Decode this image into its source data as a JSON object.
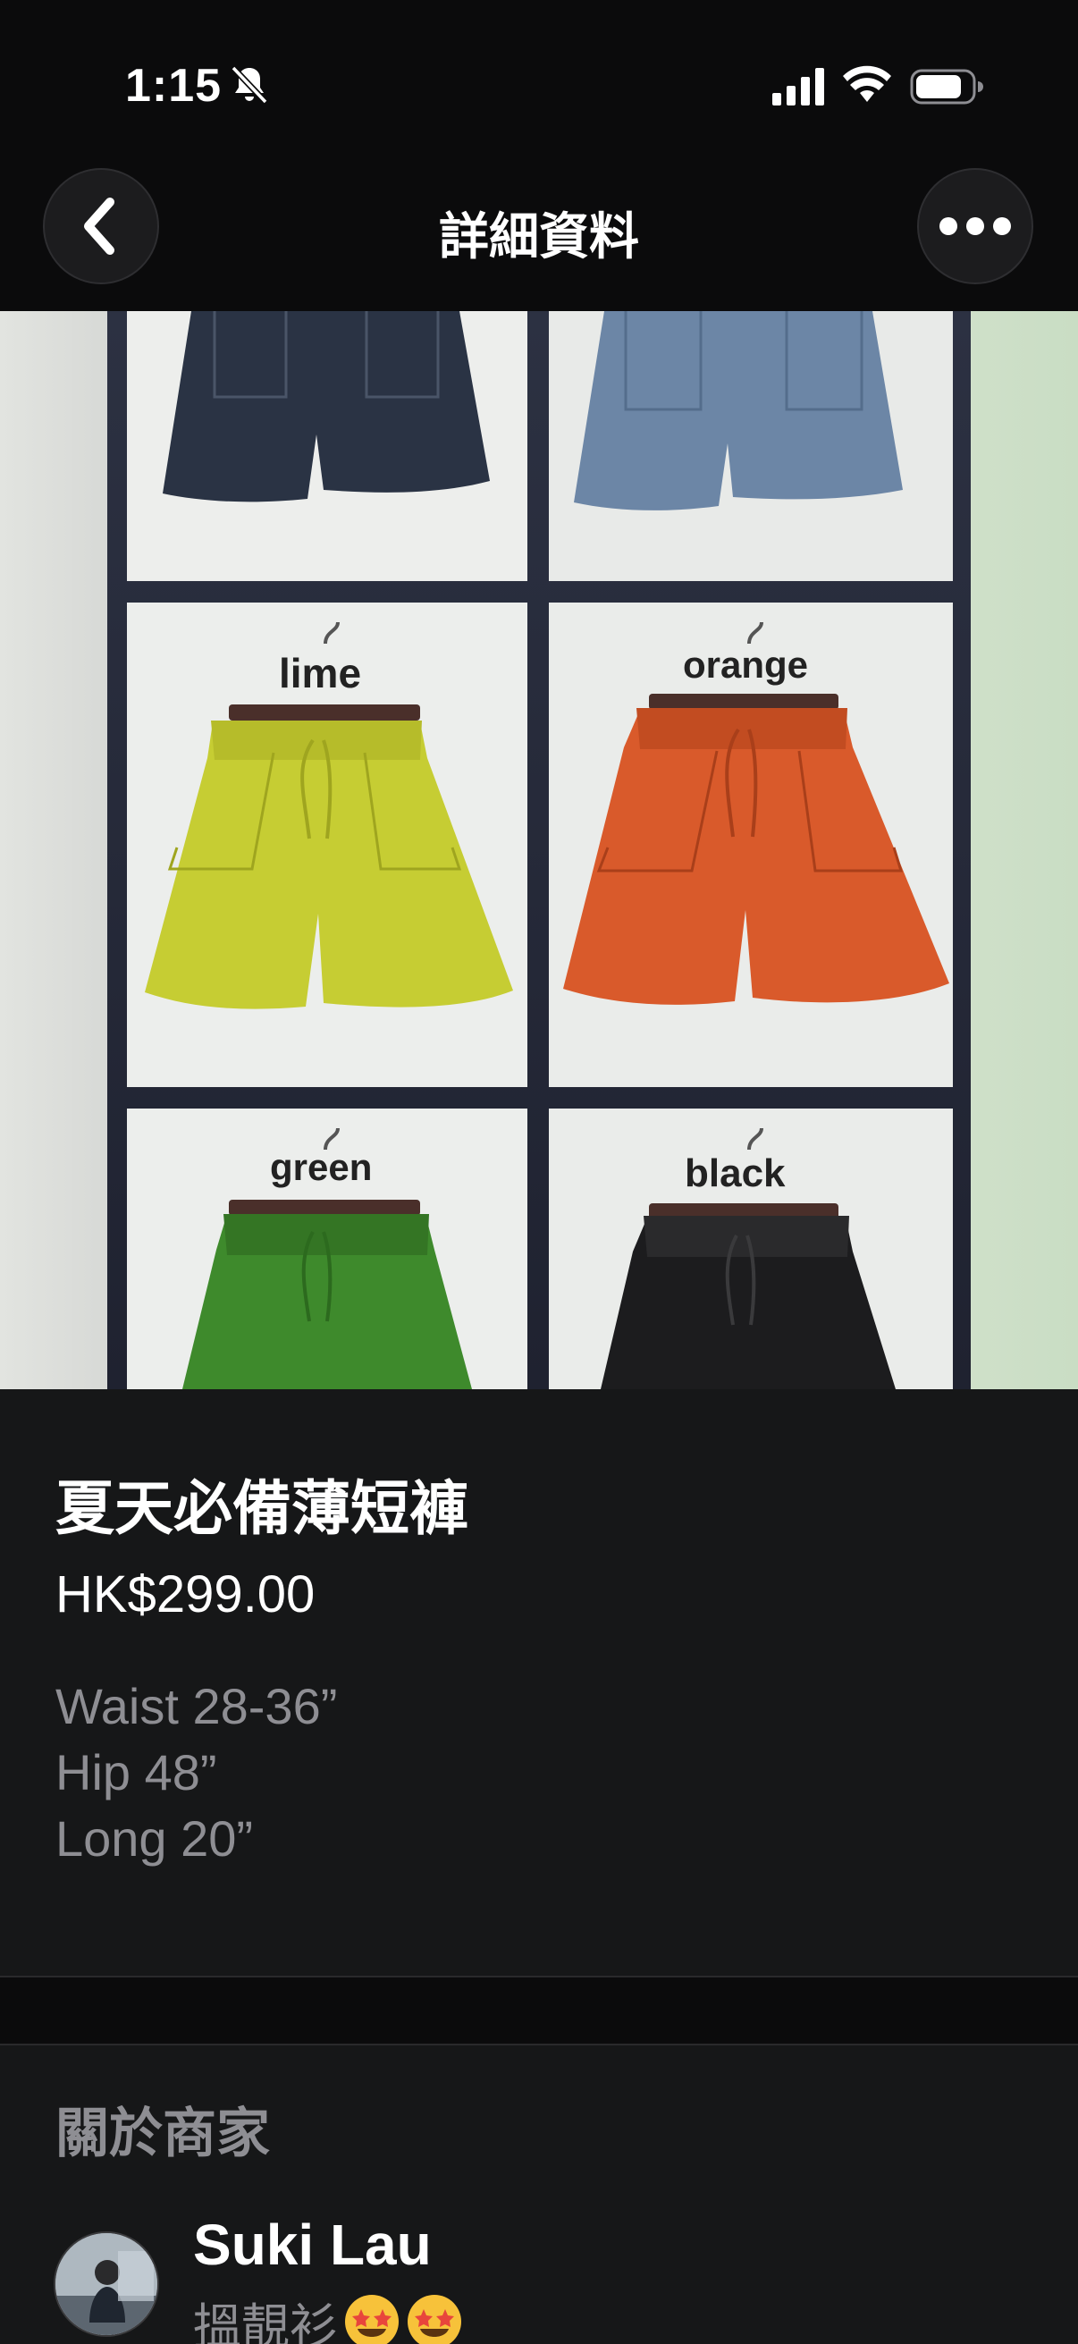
{
  "status_bar": {
    "time": "1:15",
    "icons": [
      "bell-slash-icon",
      "cellular-signal-icon",
      "wifi-icon",
      "battery-icon"
    ]
  },
  "nav": {
    "title": "詳細資料",
    "back_icon": "chevron-left-icon",
    "more_icon": "more-horizontal-icon"
  },
  "product_image": {
    "color_labels": [
      "lime",
      "orange",
      "green",
      "black"
    ],
    "colors": {
      "navy": "#2a3344",
      "denim": "#6c86a6",
      "lime": "#c6cd33",
      "orange": "#d95a2b",
      "green": "#3e8a2c",
      "black": "#1c1c1e"
    }
  },
  "product": {
    "title": "夏天必備薄短褲",
    "price": "HK$299.00",
    "description": [
      "Waist 28-36”",
      "Hip 48”",
      "Long 20”"
    ]
  },
  "merchant": {
    "heading": "關於商家",
    "name": "Suki Lau",
    "description": "搵靚衫",
    "emojis": [
      "star-struck-emoji",
      "star-struck-emoji"
    ]
  },
  "theme": {
    "background": "#0b0b0c",
    "card": "#161718",
    "secondary_text": "#8e8e93"
  }
}
